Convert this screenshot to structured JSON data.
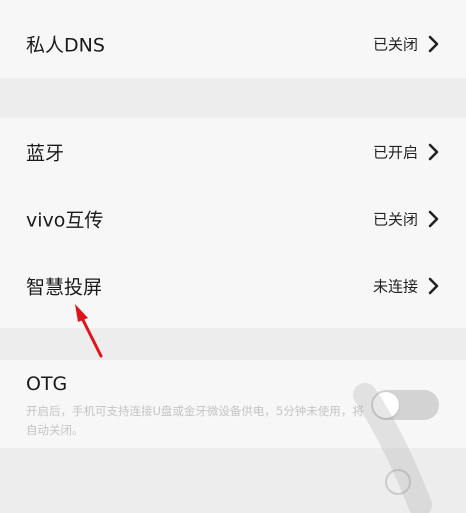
{
  "settings": {
    "private_dns": {
      "label": "私人DNS",
      "value": "已关闭",
      "chevron": "chevron-right-icon"
    },
    "bluetooth": {
      "label": "蓝牙",
      "value": "已开启",
      "chevron": "chevron-right-icon"
    },
    "vivo_share": {
      "label": "vivo互传",
      "value": "已关闭",
      "chevron": "chevron-right-icon"
    },
    "smart_mirroring": {
      "label": "智慧投屏",
      "value": "未连接",
      "chevron": "chevron-right-icon"
    }
  },
  "otg": {
    "title": "OTG",
    "description": "开启后，手机可支持连接U盘或金牙微设备供电，5分钟未使用，将自动关闭。",
    "enabled": false
  },
  "colors": {
    "background": "#ededed",
    "card": "#f7f7f7",
    "annotation_arrow": "#e0131a",
    "toggle_off": "#d3d3d3"
  }
}
